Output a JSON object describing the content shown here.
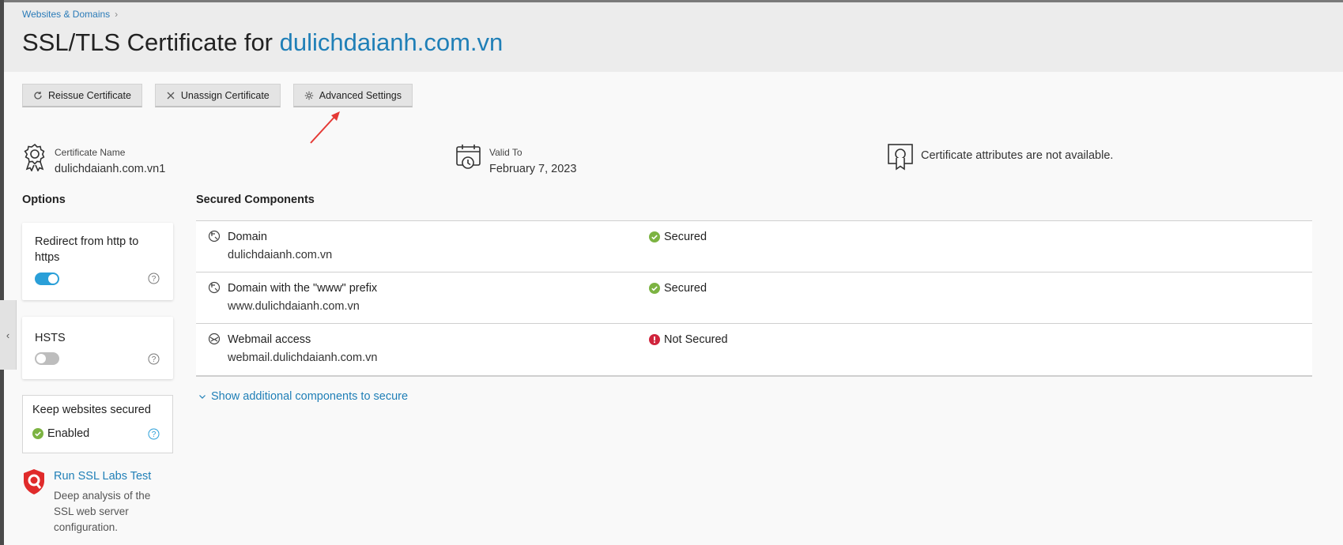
{
  "breadcrumb": {
    "item": "Websites & Domains"
  },
  "page": {
    "title_prefix": "SSL/TLS Certificate for",
    "domain": "dulichdaianh.com.vn"
  },
  "toolbar": {
    "reissue_label": "Reissue Certificate",
    "unassign_label": "Unassign Certificate",
    "advanced_label": "Advanced Settings"
  },
  "certificate": {
    "name_label": "Certificate Name",
    "name_value": "dulichdaianh.com.vn1",
    "valid_label": "Valid To",
    "valid_value": "February 7, 2023",
    "attributes_text": "Certificate attributes are not available."
  },
  "options": {
    "title": "Options",
    "redirect_label": "Redirect from http to https",
    "redirect_enabled": true,
    "hsts_label": "HSTS",
    "hsts_enabled": false,
    "keep_label": "Keep websites secured",
    "keep_status": "Enabled"
  },
  "ssl_labs": {
    "link": "Run SSL Labs Test",
    "description": "Deep analysis of the SSL web server configuration."
  },
  "secured": {
    "title": "Secured Components",
    "rows": [
      {
        "name": "Domain",
        "host": "dulichdaianh.com.vn",
        "status": "Secured",
        "state": "ok"
      },
      {
        "name": "Domain with the \"www\" prefix",
        "host": "www.dulichdaianh.com.vn",
        "status": "Secured",
        "state": "ok"
      },
      {
        "name": "Webmail access",
        "host": "webmail.dulichdaianh.com.vn",
        "status": "Not Secured",
        "state": "error"
      }
    ],
    "show_more": "Show additional components to secure"
  },
  "colors": {
    "accent": "#1f7fb7",
    "success": "#7cb342",
    "error": "#d0243c",
    "toggle_on": "#2a9fd8"
  }
}
